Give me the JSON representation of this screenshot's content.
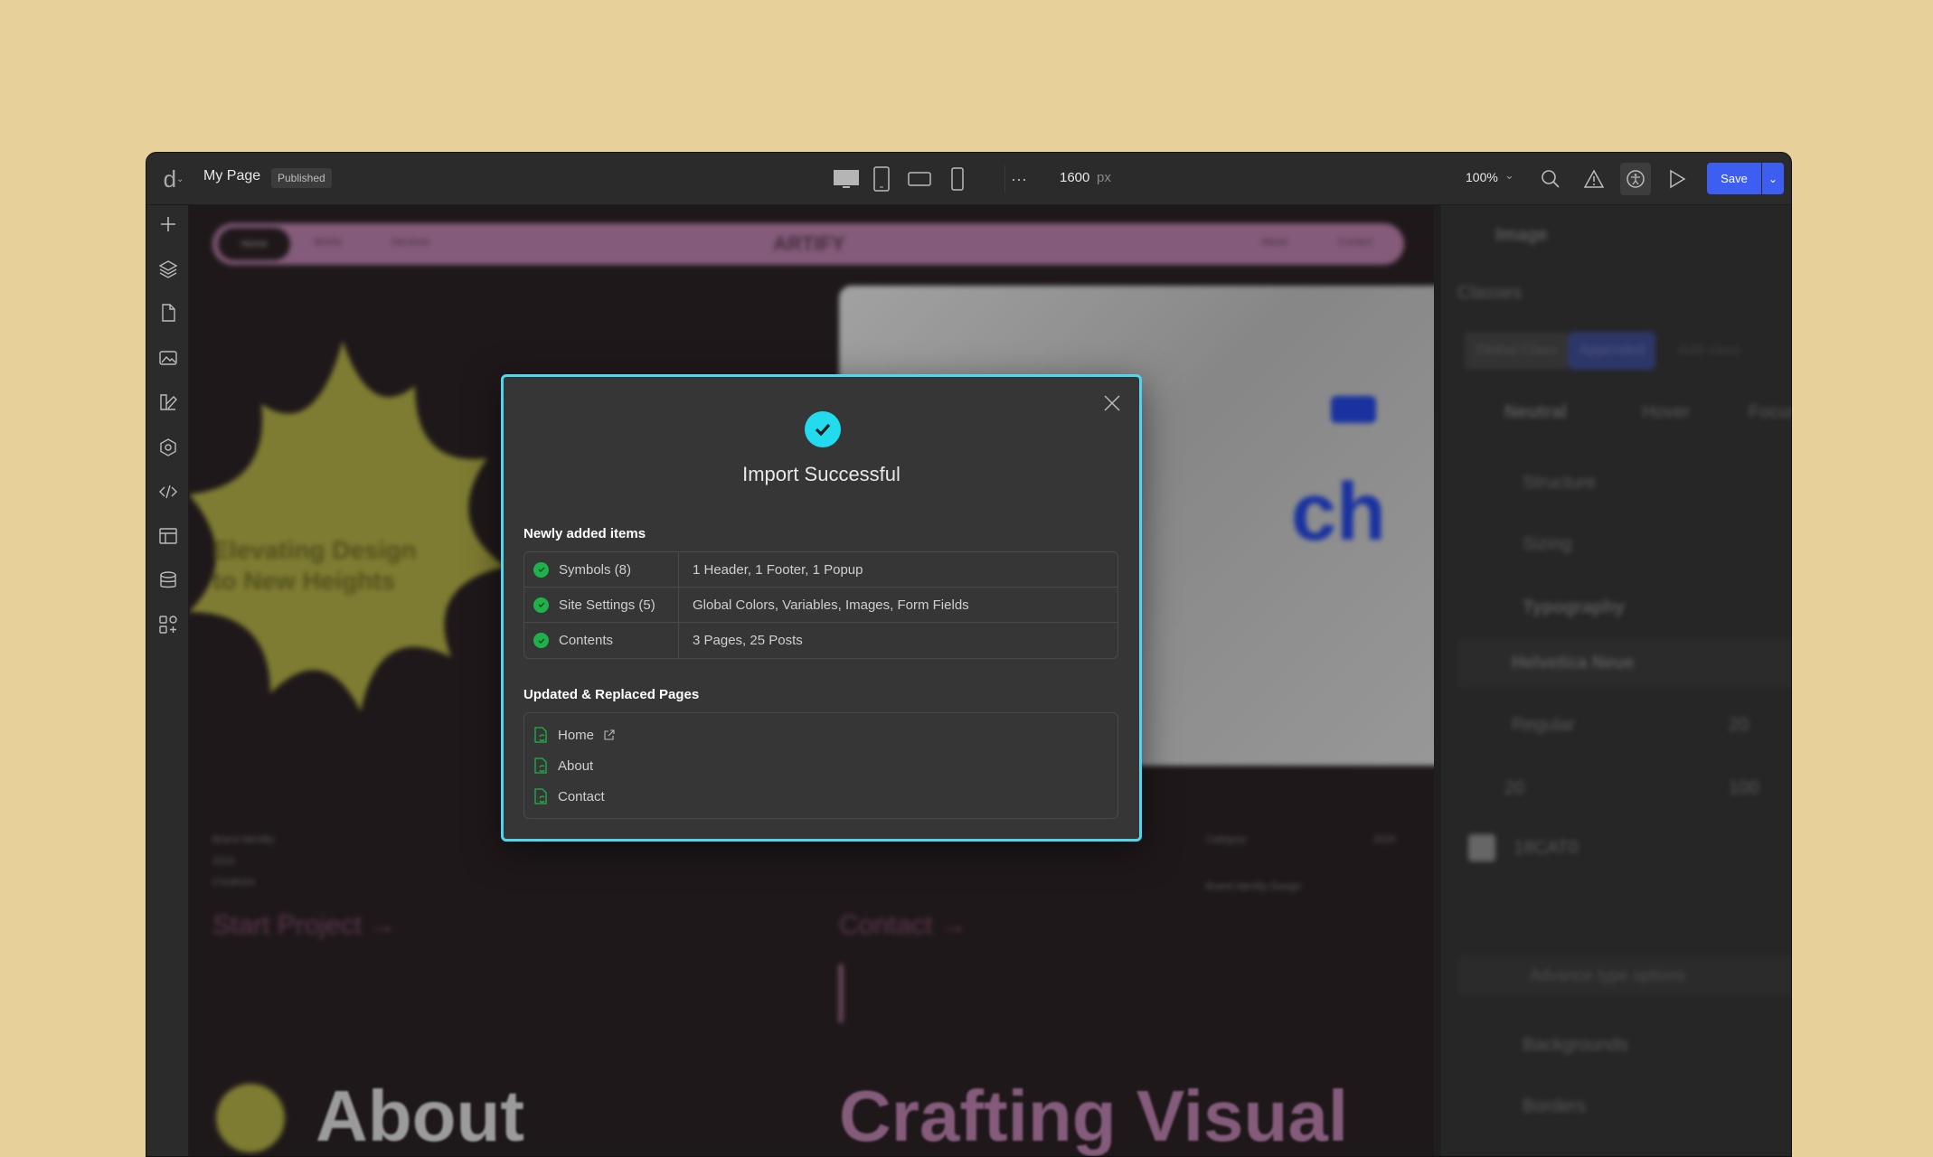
{
  "topbar": {
    "title": "My Page",
    "status": "Published",
    "width_value": "1600",
    "width_unit": "px",
    "zoom": "100%",
    "save_label": "Save"
  },
  "canvas": {
    "brand": "ARTIFY",
    "nav": [
      "Home",
      "Works",
      "Services",
      "About",
      "Contact"
    ],
    "hero_text": "Elevating Design to New Heights",
    "hero_big": "ch",
    "meta": [
      "Brand Identity",
      "2024",
      "Creatives"
    ],
    "category": "Category",
    "year": "2024",
    "caption": "Brand Identity Design",
    "cta1": "Start Project →",
    "cta2": "Contact →",
    "about": "About",
    "crafting": "Crafting Visual"
  },
  "right_panel": {
    "element": "Image",
    "classes": "Classes",
    "chips": [
      "Global Class",
      "Appended",
      "Add class"
    ],
    "states": [
      "Neutral",
      "Hover",
      "Focus"
    ],
    "sections": [
      "Structure",
      "Sizing",
      "Typography",
      "Backgrounds",
      "Borders"
    ],
    "font": "Helvetica Neue",
    "weight": "Regular",
    "size": "20",
    "line": "20",
    "spacing": "100",
    "color": "18CAT0",
    "advanced": "Advance type options"
  },
  "modal": {
    "title": "Import Successful",
    "newly_title": "Newly added items",
    "items": [
      {
        "label": "Symbols (8)",
        "detail": "1 Header, 1 Footer, 1 Popup"
      },
      {
        "label": "Site Settings (5)",
        "detail": "Global Colors, Variables, Images, Form Fields"
      },
      {
        "label": "Contents",
        "detail": "3 Pages, 25 Posts"
      }
    ],
    "updated_title": "Updated & Replaced Pages",
    "pages": [
      "Home",
      "About",
      "Contact"
    ],
    "accent": "#22dbee",
    "success": "#1fb24a"
  }
}
